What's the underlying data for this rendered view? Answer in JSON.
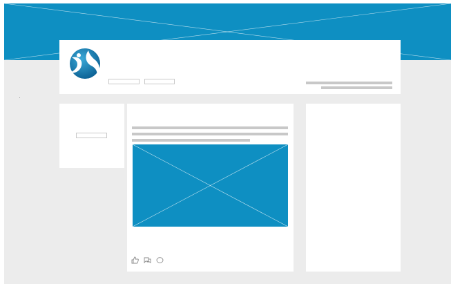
{
  "colors": {
    "page_background": "#ececec",
    "brand_blue": "#0e8fc2",
    "card_background": "#ffffff",
    "placeholder_gray": "#c8c8c8",
    "icon_gray": "#8a8a8a"
  },
  "banner": {
    "image": "cover-image-placeholder"
  },
  "profile": {
    "logo_icon": "company-logo-icon",
    "buttons": [
      {
        "name": "profile-action-button-1",
        "label": ""
      },
      {
        "name": "profile-action-button-2",
        "label": ""
      }
    ],
    "info_lines": [
      "",
      ""
    ]
  },
  "left_panel": {
    "button_label": ""
  },
  "post": {
    "text_lines": [
      "",
      "",
      ""
    ],
    "media": "post-image-placeholder",
    "actions": [
      {
        "name": "like-icon"
      },
      {
        "name": "comment-icon"
      },
      {
        "name": "share-icon"
      }
    ]
  },
  "right_panel": {
    "content": ""
  }
}
